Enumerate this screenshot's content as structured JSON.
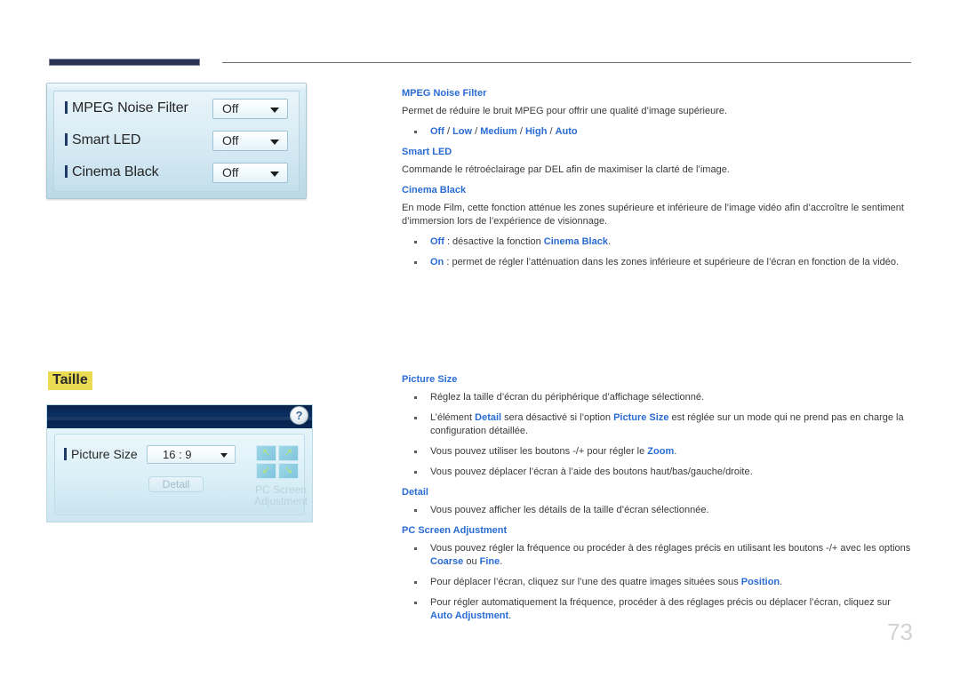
{
  "page": {
    "number": "73"
  },
  "osd_picture_options": {
    "rows": [
      {
        "label": "MPEG Noise Filter",
        "value": "Off"
      },
      {
        "label": "Smart LED",
        "value": "Off"
      },
      {
        "label": "Cinema Black",
        "value": "Off"
      }
    ]
  },
  "section": {
    "title": "Taille",
    "highlight_color": "#ebdb52"
  },
  "osd_picture_size": {
    "help_label": "?",
    "picture_size_label": "Picture Size",
    "picture_size_value": "16 : 9",
    "detail_button": "Detail",
    "pc_screen_adjustment_caption": "PC Screen\nAdjustment",
    "arrows": [
      "↖",
      "↗",
      "↙",
      "↘"
    ]
  },
  "content": {
    "mpeg_noise_filter": {
      "heading": "MPEG Noise Filter",
      "paragraph": "Permet de réduire le bruit MPEG pour offrir une qualité d’image supérieure.",
      "options_bullet": {
        "off": "Off",
        "low": "Low",
        "medium": "Medium",
        "high": "High",
        "auto": "Auto",
        "separator": " / "
      }
    },
    "smart_led": {
      "heading": "Smart LED",
      "paragraph": "Commande le rétroéclairage par DEL afin de maximiser la clarté de l’image."
    },
    "cinema_black": {
      "heading": "Cinema Black",
      "paragraph": "En mode Film, cette fonction atténue les zones supérieure et inférieure de l’image vidéo afin d’accroître le sentiment d’immersion lors de l’expérience de visionnage.",
      "bullet_off_pre": "Off",
      "bullet_off_mid": " : désactive la fonction ",
      "bullet_off_bold": "Cinema Black",
      "bullet_off_end": ".",
      "bullet_on_pre": "On",
      "bullet_on_text": " : permet de régler l’atténuation dans les zones inférieure et supérieure de l’écran en fonction de la vidéo."
    },
    "picture_size": {
      "heading": "Picture Size",
      "b1": "Réglez la taille d’écran du périphérique d’affichage sélectionné.",
      "b2_a": "L’élément ",
      "b2_bold1": "Detail",
      "b2_b": " sera désactivé si l’option ",
      "b2_bold2": "Picture Size",
      "b2_c": " est réglée sur un mode qui ne prend pas en charge la configuration détaillée.",
      "b3_a": "Vous pouvez utiliser les boutons -/+ pour régler le ",
      "b3_bold": "Zoom",
      "b3_b": ".",
      "b4": "Vous pouvez déplacer l’écran à l’aide des boutons haut/bas/gauche/droite."
    },
    "detail": {
      "heading": "Detail",
      "b1": "Vous pouvez afficher les détails de la taille d’écran sélectionnée."
    },
    "pc_screen_adjustment": {
      "heading": "PC Screen Adjustment",
      "b1_a": "Vous pouvez régler la fréquence ou procéder à des réglages précis en utilisant les boutons -/+ avec les options ",
      "b1_bold1": "Coarse",
      "b1_b": " ou ",
      "b1_bold2": "Fine",
      "b1_c": ".",
      "b2_a": "Pour déplacer l’écran, cliquez sur l’une des quatre images situées sous ",
      "b2_bold": "Position",
      "b2_b": ".",
      "b3_a": "Pour régler automatiquement la fréquence, procéder à des réglages précis ou déplacer l’écran, cliquez sur ",
      "b3_bold": "Auto Adjustment",
      "b3_b": "."
    }
  }
}
